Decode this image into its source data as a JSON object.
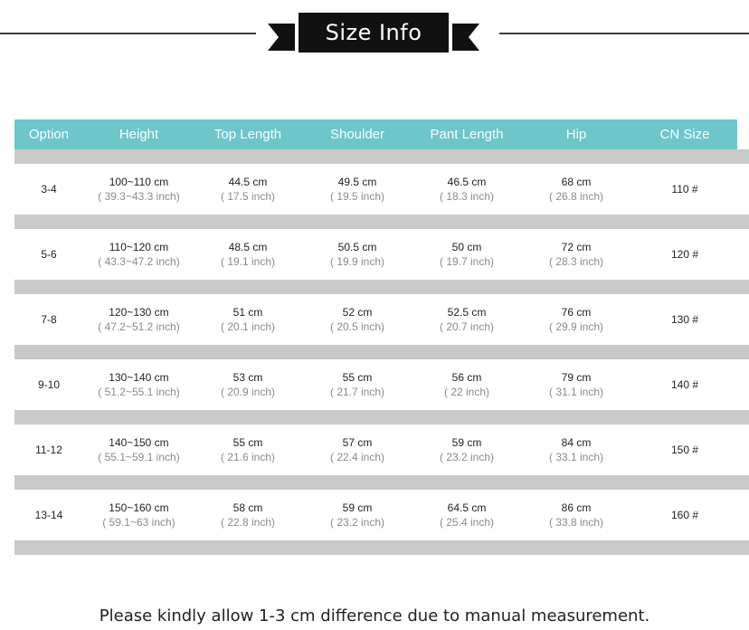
{
  "banner": {
    "title": "Size Info",
    "bg_color": "#111111",
    "line_color": "#3a3a3a"
  },
  "table": {
    "header_color": "#6cc6ca",
    "band_color": "#c9c9c9",
    "columns": [
      "Option",
      "Height",
      "Top Length",
      "Shoulder",
      "Pant Length",
      "Hip",
      "CN Size"
    ],
    "rows": [
      {
        "option": "3-4",
        "height": {
          "cm": "100~110 cm",
          "inch": "( 39.3~43.3 inch)"
        },
        "top_length": {
          "cm": "44.5 cm",
          "inch": "( 17.5 inch)"
        },
        "shoulder": {
          "cm": "49.5 cm",
          "inch": "( 19.5 inch)"
        },
        "pant_length": {
          "cm": "46.5 cm",
          "inch": "( 18.3 inch)"
        },
        "hip": {
          "cm": "68 cm",
          "inch": "( 26.8 inch)"
        },
        "cn_size": "110 #"
      },
      {
        "option": "5-6",
        "height": {
          "cm": "110~120 cm",
          "inch": "( 43.3~47.2 inch)"
        },
        "top_length": {
          "cm": "48.5 cm",
          "inch": "( 19.1 inch)"
        },
        "shoulder": {
          "cm": "50.5 cm",
          "inch": "( 19.9 inch)"
        },
        "pant_length": {
          "cm": "50 cm",
          "inch": "( 19.7 inch)"
        },
        "hip": {
          "cm": "72 cm",
          "inch": "( 28.3 inch)"
        },
        "cn_size": "120 #"
      },
      {
        "option": "7-8",
        "height": {
          "cm": "120~130 cm",
          "inch": "( 47.2~51.2 inch)"
        },
        "top_length": {
          "cm": "51 cm",
          "inch": "( 20.1 inch)"
        },
        "shoulder": {
          "cm": "52 cm",
          "inch": "( 20.5 inch)"
        },
        "pant_length": {
          "cm": "52.5 cm",
          "inch": "( 20.7 inch)"
        },
        "hip": {
          "cm": "76 cm",
          "inch": "( 29.9 inch)"
        },
        "cn_size": "130 #"
      },
      {
        "option": "9-10",
        "height": {
          "cm": "130~140 cm",
          "inch": "( 51.2~55.1 inch)"
        },
        "top_length": {
          "cm": "53 cm",
          "inch": "( 20.9 inch)"
        },
        "shoulder": {
          "cm": "55 cm",
          "inch": "( 21.7 inch)"
        },
        "pant_length": {
          "cm": "56 cm",
          "inch": "( 22 inch)"
        },
        "hip": {
          "cm": "79 cm",
          "inch": "( 31.1 inch)"
        },
        "cn_size": "140 #"
      },
      {
        "option": "11-12",
        "height": {
          "cm": "140~150 cm",
          "inch": "( 55.1~59.1 inch)"
        },
        "top_length": {
          "cm": "55 cm",
          "inch": "( 21.6 inch)"
        },
        "shoulder": {
          "cm": "57 cm",
          "inch": "( 22.4 inch)"
        },
        "pant_length": {
          "cm": "59 cm",
          "inch": "( 23.2 inch)"
        },
        "hip": {
          "cm": "84 cm",
          "inch": "( 33.1 inch)"
        },
        "cn_size": "150 #"
      },
      {
        "option": "13-14",
        "height": {
          "cm": "150~160 cm",
          "inch": "( 59.1~63 inch)"
        },
        "top_length": {
          "cm": "58 cm",
          "inch": "( 22.8 inch)"
        },
        "shoulder": {
          "cm": "59 cm",
          "inch": "( 23.2 inch)"
        },
        "pant_length": {
          "cm": "64.5 cm",
          "inch": "( 25.4 inch)"
        },
        "hip": {
          "cm": "86 cm",
          "inch": "( 33.8 inch)"
        },
        "cn_size": "160 #"
      }
    ]
  },
  "footnote": "Please kindly allow 1-3 cm difference due to manual measurement."
}
